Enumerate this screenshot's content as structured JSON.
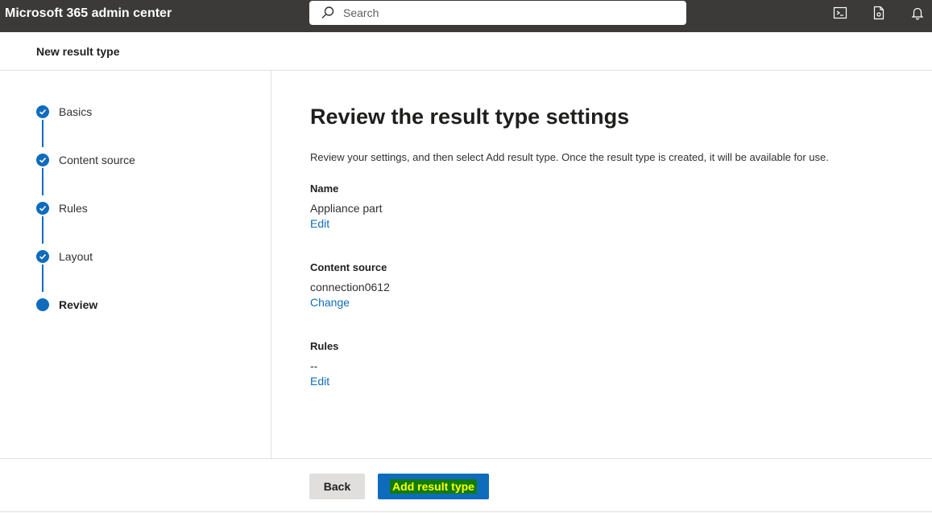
{
  "topbar": {
    "app_title": "Microsoft 365 admin center",
    "search_placeholder": "Search",
    "icons": [
      "terminal-icon",
      "document-settings-icon",
      "bell-icon"
    ]
  },
  "panel": {
    "title": "New result type"
  },
  "steps": [
    {
      "label": "Basics",
      "status": "completed"
    },
    {
      "label": "Content source",
      "status": "completed"
    },
    {
      "label": "Rules",
      "status": "completed"
    },
    {
      "label": "Layout",
      "status": "completed"
    },
    {
      "label": "Review",
      "status": "current"
    }
  ],
  "main": {
    "heading": "Review the result type settings",
    "description": "Review your settings, and then select Add result type. Once the result type is created, it will be available for use.",
    "sections": [
      {
        "label": "Name",
        "value": "Appliance part",
        "link": "Edit"
      },
      {
        "label": "Content source",
        "value": "connection0612",
        "link": "Change"
      },
      {
        "label": "Rules",
        "value": "--",
        "link": "Edit"
      }
    ]
  },
  "footer": {
    "back_label": "Back",
    "add_label": "Add result type"
  },
  "colors": {
    "accent": "#0f6cbd",
    "topbar": "#3b3a39",
    "highlight_bg": "#107c10",
    "highlight_text": "#ffff00"
  }
}
